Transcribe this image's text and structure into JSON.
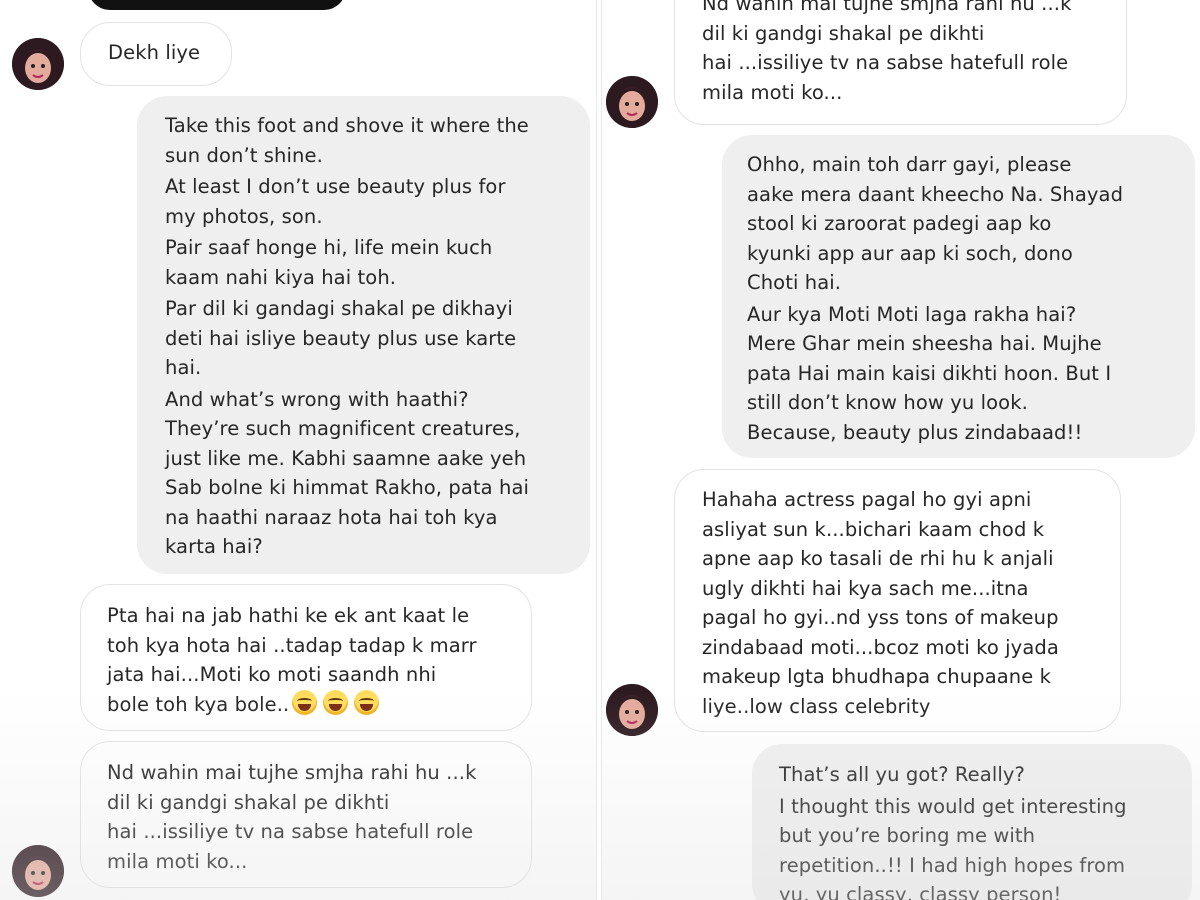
{
  "left": {
    "messages": [
      {
        "id": "m1",
        "lines": [
          "Dekh liye"
        ]
      },
      {
        "id": "m2",
        "paragraphs": [
          [
            "Take this foot and shove it where the",
            "sun don’t shine."
          ],
          [
            "At least I don’t use beauty plus for",
            "my photos, son."
          ],
          [
            "Pair saaf honge hi, life mein kuch",
            "kaam nahi kiya hai toh."
          ],
          [
            "Par dil ki gandagi shakal pe dikhayi",
            "deti hai isliye beauty plus use karte",
            "hai."
          ],
          [
            "And what’s wrong with haathi?",
            "They’re such magnificent creatures,",
            "just like me. Kabhi saamne aake yeh",
            "Sab bolne ki himmat Rakho, pata hai",
            "na haathi naraaz hota hai toh kya",
            "karta hai?"
          ]
        ]
      },
      {
        "id": "m3",
        "lines": [
          "Pta hai na jab hathi ke ek ant kaat le",
          "toh kya hota hai ..tadap tadap k marr",
          "jata hai...Moti ko moti saandh nhi",
          "bole toh kya bole.."
        ],
        "emoji_count": 3,
        "emoji_name": "joy-emoji"
      },
      {
        "id": "m4",
        "lines": [
          "Nd wahin mai tujhe smjha rahi hu ...k",
          "dil ki gandgi shakal pe dikhti",
          "hai ...issiliye tv na sabse hatefull role",
          "mila moti ko..."
        ]
      }
    ]
  },
  "right": {
    "messages": [
      {
        "id": "r1",
        "lines": [
          "Nd wahin mai tujhe smjha rahi hu ...k",
          "dil ki gandgi shakal pe dikhti",
          "hai ...issiliye tv na sabse hatefull role",
          "mila moti ko..."
        ]
      },
      {
        "id": "r2",
        "paragraphs": [
          [
            "Ohho, main toh darr gayi, please",
            "aake mera daant kheecho Na. Shayad",
            "stool ki zaroorat padegi aap ko",
            "kyunki app aur aap ki soch, dono",
            "Choti hai."
          ],
          [
            "Aur kya Moti Moti laga rakha hai?",
            "Mere Ghar mein sheesha hai. Mujhe",
            "pata Hai main kaisi dikhti hoon. But I",
            "still don’t know how yu look.",
            "Because, beauty plus zindabaad!!"
          ]
        ]
      },
      {
        "id": "r3",
        "lines": [
          "Hahaha actress pagal ho gyi apni",
          "asliyat sun k...bichari kaam chod k",
          "apne aap ko tasali de rhi hu k anjali",
          "ugly dikhti hai kya sach me...itna",
          "pagal ho gyi..nd yss tons of makeup",
          "zindabaad moti...bcoz moti ko jyada",
          "makeup lgta bhudhapa chupaane k",
          "liye..low class celebrity"
        ]
      },
      {
        "id": "r4",
        "paragraphs": [
          [
            "That’s all yu got? Really?"
          ],
          [
            "I thought this would get interesting",
            "but you’re boring me with",
            "repetition..!! I had high hopes from",
            "yu, yu classy, classy person!"
          ]
        ]
      }
    ]
  },
  "icons": {
    "avatar": "profile-avatar-icon",
    "emoji": "joy-emoji"
  }
}
